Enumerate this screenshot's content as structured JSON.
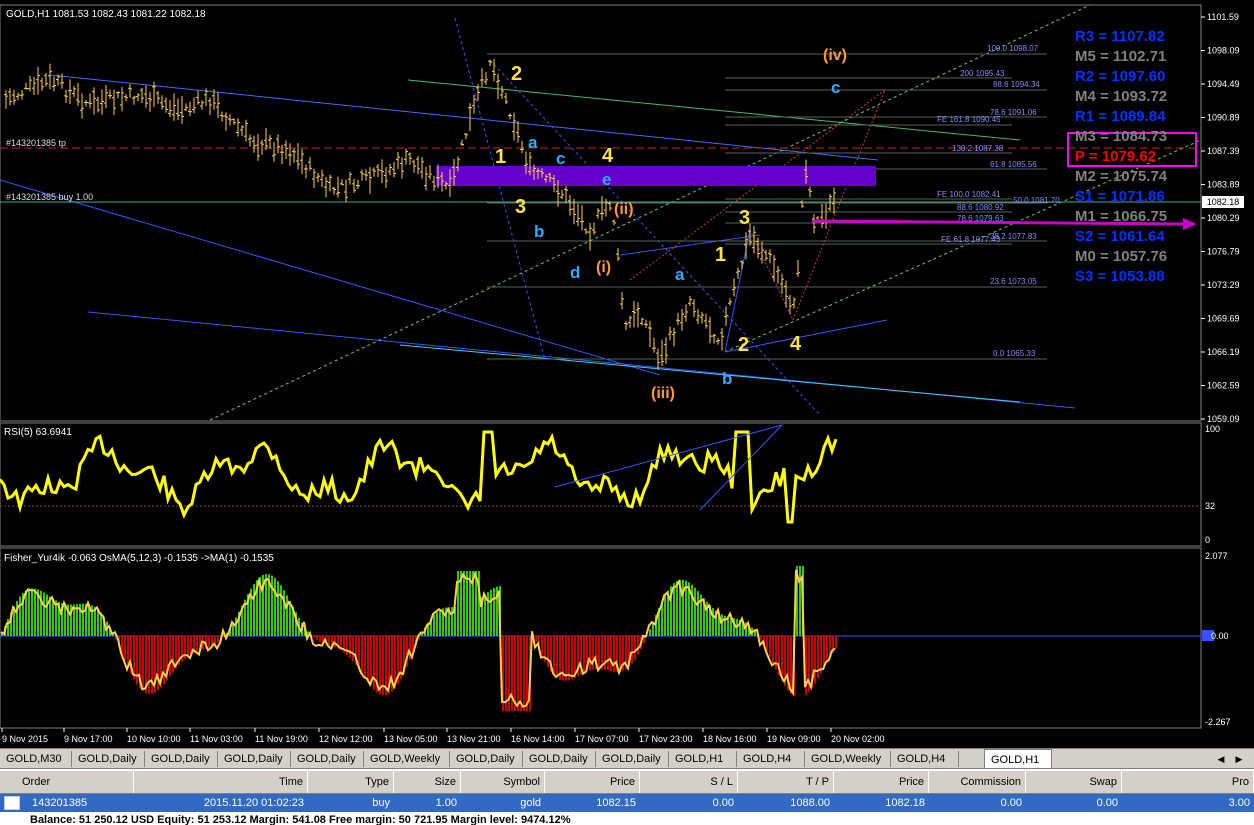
{
  "colors": {
    "background": "#000000",
    "bull_candle": "#ffd24d",
    "rsi_line": "#ffff00",
    "osma_pos": "#33cc00",
    "osma_neg": "#cc0000",
    "fisher_line": "#ffd24d",
    "wave_yellow": "#ffe14d",
    "wave_cyan": "#33aaff",
    "wave_orange": "#ff9933",
    "pivot_blue": "#0033ff",
    "pivot_gray": "#808080",
    "pivot_red": "#ff0000",
    "arrow_magenta": "#cc00cc",
    "zone_purple": "#6600cc"
  },
  "main_chart": {
    "title": "GOLD,H1  1081.53 1082.43 1081.22 1082.18",
    "order_tp_label": "#143201385 tp",
    "order_buy_label": "#143201385 buy 1.00",
    "price_axis": [
      "1101.59",
      "1098.09",
      "1094.49",
      "1090.89",
      "1087.39",
      "1083.89",
      "1080.29",
      "1076.79",
      "1073.29",
      "1069.69",
      "1066.19",
      "1062.59",
      "1059.09"
    ],
    "current_price": "1082.18",
    "fib_labels": [
      "100.0 1098.07",
      "200 1095.43",
      "88.6 1094.34",
      "78.6 1091.06",
      "FE 161.8 1090.45",
      "130.2 1087.38",
      "61.8 1085.56",
      "FE 100.0 1082.41",
      "50.0 1081.70",
      "88.6 1080.92",
      "78.6 1079.63",
      "38.2 1077.83",
      "FE 61.8 1077.43",
      "23.6 1073.05",
      "0.0 1065.33"
    ],
    "pivots": [
      {
        "label": "R3 = 1107.82",
        "color": "#0033ff"
      },
      {
        "label": "M5 = 1102.71",
        "color": "#808080"
      },
      {
        "label": "R2 = 1097.60",
        "color": "#0033ff"
      },
      {
        "label": "M4 = 1093.72",
        "color": "#808080"
      },
      {
        "label": "R1 = 1089.84",
        "color": "#0033ff"
      },
      {
        "label": "M3 = 1084.73",
        "color": "#808080"
      },
      {
        "label": "P  = 1079.62",
        "color": "#ff0000"
      },
      {
        "label": "M2 = 1075.74",
        "color": "#808080"
      },
      {
        "label": "S1 = 1071.86",
        "color": "#0033ff"
      },
      {
        "label": "M1 = 1066.75",
        "color": "#808080"
      },
      {
        "label": "S2 = 1061.64",
        "color": "#0033ff"
      },
      {
        "label": "M0 = 1057.76",
        "color": "#808080"
      },
      {
        "label": "S3 = 1053.88",
        "color": "#0033ff"
      }
    ],
    "wave_labels": {
      "w2a": "2",
      "w1a": "1",
      "w3a": "3",
      "w4a": "4",
      "wa1": "a",
      "wc1": "c",
      "we1": "e",
      "wb1": "b",
      "wd1": "d",
      "wii": "(ii)",
      "wi": "(i)",
      "wiii": "(iii)",
      "wiv": "(iv)",
      "wa2": "a",
      "wb2": "b",
      "wc2": "c",
      "w1b": "1",
      "w2b": "2",
      "w3b": "3",
      "w4b": "4"
    }
  },
  "rsi": {
    "title": "RSI(5) 63.6941",
    "axis": [
      "100",
      "32",
      "0"
    ]
  },
  "fisher": {
    "title": "Fisher_Yur4ik -0.063  OsMA(5,12,3) -0.1535  ->MA(1) -0.1535",
    "axis": [
      "2.077",
      "0.00",
      "-2.267"
    ]
  },
  "time_axis": [
    "9 Nov 2015",
    "9 Nov 17:00",
    "10 Nov 10:00",
    "11 Nov 03:00",
    "11 Nov 19:00",
    "12 Nov 12:00",
    "13 Nov 05:00",
    "13 Nov 21:00",
    "16 Nov 14:00",
    "17 Nov 07:00",
    "17 Nov 23:00",
    "18 Nov 16:00",
    "19 Nov 09:00",
    "20 Nov 02:00"
  ],
  "tabs": [
    "GOLD,M30",
    "GOLD,Daily",
    "GOLD,Daily",
    "GOLD,Daily",
    "GOLD,Daily",
    "GOLD,Weekly",
    "GOLD,Daily",
    "GOLD,Daily",
    "GOLD,Daily",
    "GOLD,H1",
    "GOLD,H4",
    "GOLD,Weekly",
    "GOLD,H4",
    "GOLD,H1"
  ],
  "active_tab": "GOLD,H1",
  "terminal": {
    "columns": [
      "Order",
      "Time",
      "Type",
      "Size",
      "Symbol",
      "Price",
      "S / L",
      "T / P",
      "Price",
      "Commission",
      "Swap",
      "Pro"
    ],
    "row": [
      "143201385",
      "2015.11.20 01:02:23",
      "buy",
      "1.00",
      "gold",
      "1082.15",
      "0.00",
      "1088.00",
      "1082.18",
      "0.00",
      "0.00",
      "3.00"
    ],
    "balance": "Balance: 51 250.12 USD  Equity: 51 253.12  Margin: 541.08  Free margin: 50 721.95  Margin level: 9474.12%"
  }
}
